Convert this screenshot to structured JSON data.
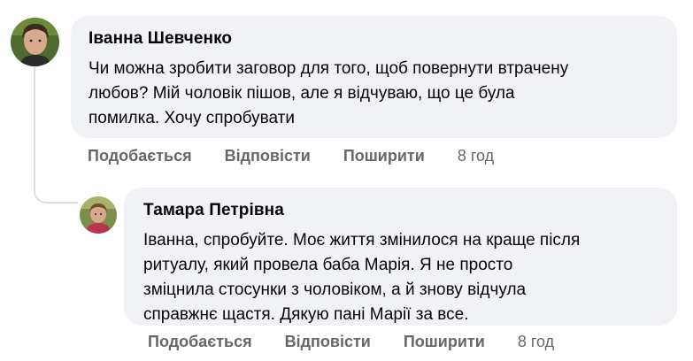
{
  "comments": [
    {
      "author": "Іванна Шевченко",
      "text": "Чи можна зробити заговор для того, щоб повернути втрачену\nлюбов? Мій чоловік пішов, але я відчуваю, що це була\nпомилка. Хочу спробувати",
      "actions": {
        "like": "Подобається",
        "reply": "Відповісти",
        "share": "Поширити"
      },
      "time": "8 год"
    },
    {
      "author": "Тамара Петрівна",
      "text": "Іванна, спробуйте. Моє життя змінилося на краще після\nритуалу, який провела баба Марія. Я не просто\nзміцнила стосунки з чоловіком, а й знову відчула\nсправжнє щастя. Дякую пані Марії за все.",
      "actions": {
        "like": "Подобається",
        "reply": "Відповісти",
        "share": "Поширити"
      },
      "time": "8 год"
    }
  ],
  "colors": {
    "bubble": "#f0f2f5",
    "meta": "#65676b",
    "thread": "#dadde1",
    "text": "#050505"
  }
}
